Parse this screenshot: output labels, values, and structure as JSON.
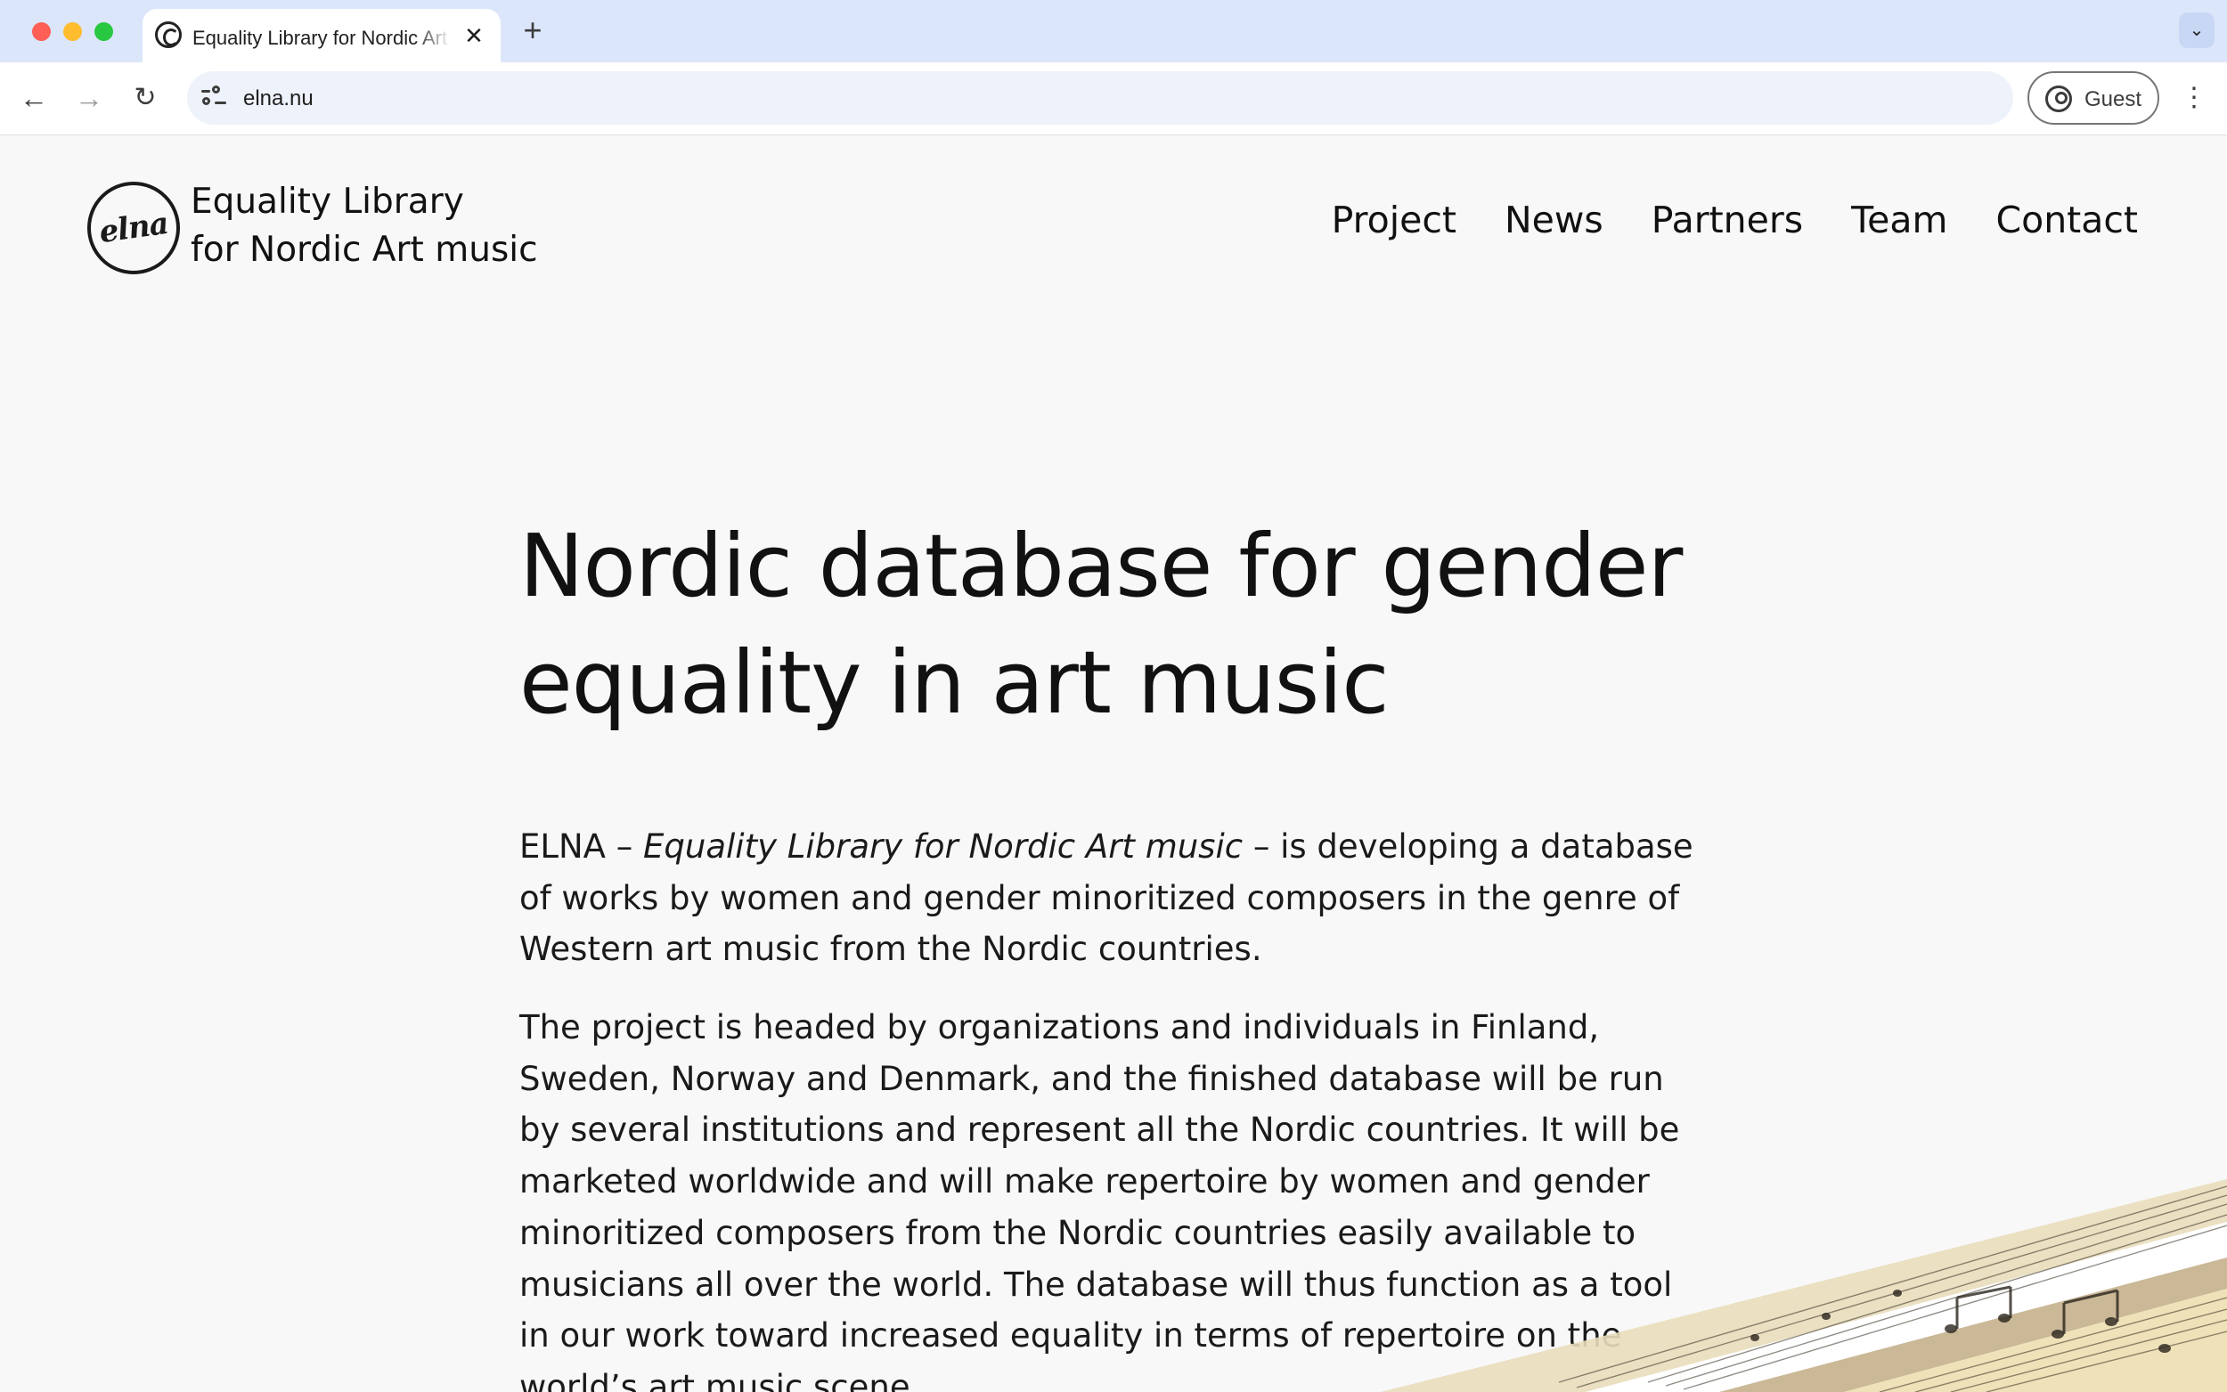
{
  "browser": {
    "tab": {
      "title": "Equality Library for Nordic Art music",
      "close_glyph": "✕"
    },
    "new_tab_glyph": "+",
    "tabs_menu_glyph": "⌄",
    "nav": {
      "back_glyph": "←",
      "forward_glyph": "→",
      "reload_glyph": "↻"
    },
    "address": "elna.nu",
    "profile_label": "Guest",
    "menu_glyph": "⋮"
  },
  "site": {
    "logo_text": "elna",
    "brand_line1": "Equality Library",
    "brand_line2": "for Nordic Art music",
    "nav": [
      "Project",
      "News",
      "Partners",
      "Team",
      "Contact"
    ]
  },
  "hero": {
    "title_line1": "Nordic database for gender",
    "title_line2": "equality in art music"
  },
  "intro": {
    "prefix": "ELNA – ",
    "italic": "Equality Library for Nordic Art music",
    "suffix": " – is developing a database of works by women and gender minoritized composers in the genre of Western art music from the Nordic countries.",
    "paragraph2": "The project is headed by organizations and individuals in Finland, Sweden, Norway and Denmark, and the finished database will be run by several insti­tutions and represent all the Nordic countries. It will be marketed worldwide and will make repertoire by women and gender minoritized composers from the Nordic countries easily available to musicians all over the world. The database will thus function as a tool in our work toward increased equality in terms of repertoire on the world’s art music scene."
  },
  "colors": {
    "page_bg": "#f8f8f8",
    "text": "#111111",
    "chrome_bg": "#dbe6fb",
    "score_paper": "#efe2b8"
  }
}
